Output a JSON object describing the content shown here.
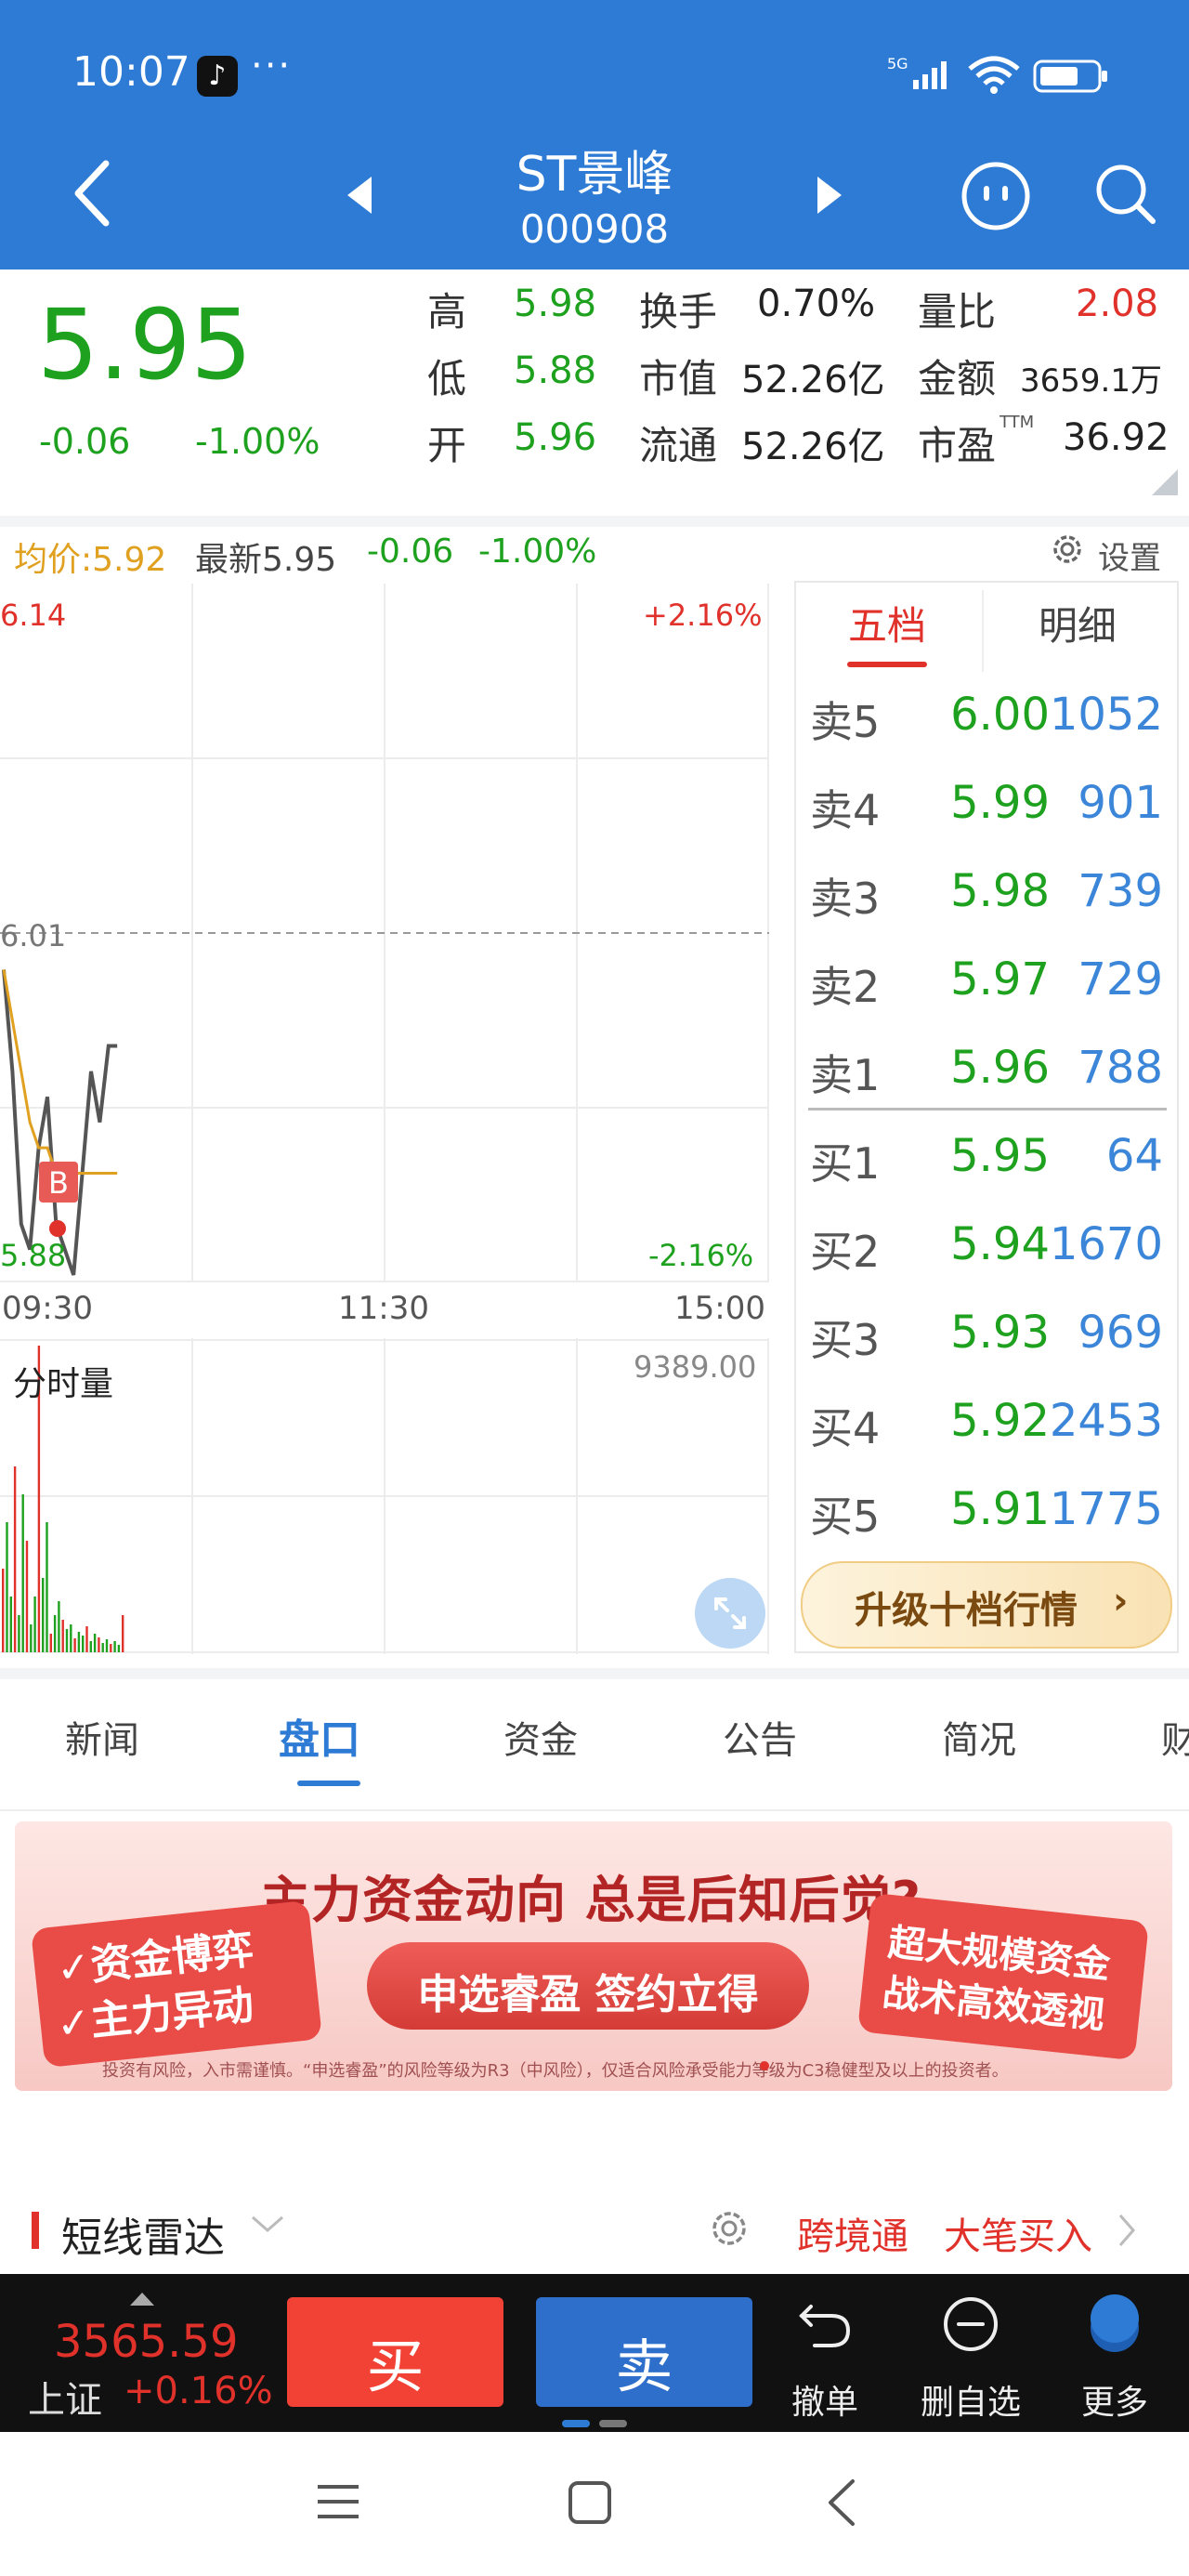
{
  "status_bar": {
    "time": "10:07",
    "dots": "···",
    "network": "5G"
  },
  "header": {
    "stock_name": "ST景峰",
    "stock_code": "000908"
  },
  "quote": {
    "price": "5.95",
    "change": "-0.06",
    "change_pct": "-1.00%",
    "high_label": "高",
    "high": "5.98",
    "low_label": "低",
    "low": "5.88",
    "open_label": "开",
    "open": "5.96",
    "turnover_label": "换手",
    "turnover": "0.70%",
    "mktcap_label": "市值",
    "mktcap": "52.26亿",
    "float_label": "流通",
    "float": "52.26亿",
    "volratio_label": "量比",
    "volratio": "2.08",
    "amount_label": "金额",
    "amount": "3659.1万",
    "pe_label": "市盈",
    "pe_sup": "TTM",
    "pe": "36.92"
  },
  "chart_info": {
    "avg": "均价:5.92",
    "latest": "最新5.95",
    "latest_change": "-0.06",
    "latest_pct": "-1.00%",
    "settings": "设置"
  },
  "chart": {
    "price_top": "6.14",
    "price_mid": "6.01",
    "price_bottom": "5.88",
    "pct_top": "+2.16%",
    "pct_bottom": "-2.16%",
    "times": [
      "09:30",
      "11:30",
      "15:00"
    ],
    "marker": "B",
    "volume_title": "分时量",
    "volume_max": "9389.00"
  },
  "chart_data": {
    "type": "line",
    "title": "",
    "ylim": [
      5.88,
      6.14
    ],
    "reference_price": 6.01,
    "x": [
      "09:30",
      "11:30",
      "15:00"
    ],
    "series": [
      {
        "name": "",
        "color": "#555555",
        "values": [
          6.0,
          5.96,
          5.9,
          5.89,
          5.93,
          5.95,
          5.9,
          5.89,
          5.88,
          5.92,
          5.96,
          5.94,
          5.97,
          5.97
        ]
      },
      {
        "name": "",
        "color": "#e0a020",
        "values": [
          6.0,
          5.98,
          5.96,
          5.94,
          5.93,
          5.93,
          5.92,
          5.92,
          5.92,
          5.92,
          5.92,
          5.92,
          5.92,
          5.92
        ]
      }
    ]
  },
  "order_book": {
    "tabs": [
      "五档",
      "明细"
    ],
    "asks": [
      {
        "label": "卖5",
        "price": "6.00",
        "volume": "1052"
      },
      {
        "label": "卖4",
        "price": "5.99",
        "volume": "901"
      },
      {
        "label": "卖3",
        "price": "5.98",
        "volume": "739"
      },
      {
        "label": "卖2",
        "price": "5.97",
        "volume": "729"
      },
      {
        "label": "卖1",
        "price": "5.96",
        "volume": "788"
      }
    ],
    "bids": [
      {
        "label": "买1",
        "price": "5.95",
        "volume": "64"
      },
      {
        "label": "买2",
        "price": "5.94",
        "volume": "1670"
      },
      {
        "label": "买3",
        "price": "5.93",
        "volume": "969"
      },
      {
        "label": "买4",
        "price": "5.92",
        "volume": "2453"
      },
      {
        "label": "买5",
        "price": "5.91",
        "volume": "1775"
      }
    ],
    "upgrade": "升级十档行情",
    "upgrade_chevron": "›"
  },
  "tabs": [
    "新闻",
    "盘口",
    "资金",
    "公告",
    "简况",
    "财"
  ],
  "banner": {
    "headline": "主力资金动向 总是后知后觉?",
    "left_1": "✓资金博弈",
    "left_2": "✓主力异动",
    "cta": "申选睿盈  签约立得",
    "right_1": "超大规模资金",
    "right_2": "战术高效透视",
    "disclaimer": "投资有风险，入市需谨慎。“申选睿盈”的风险等级为R3（中风险），仅适合风险承受能力等级为C3稳健型及以上的投资者。"
  },
  "radar": {
    "title": "短线雷达",
    "link_1": "跨境通",
    "link_2": "大笔买入"
  },
  "trade_bar": {
    "index_value": "3565.59",
    "index_name": "上证",
    "index_pct": "+0.16%",
    "buy": "买",
    "sell": "卖",
    "undo": "撤单",
    "remove_fav": "删自选",
    "more": "更多"
  },
  "colors": {
    "header": "#2e7bd6",
    "up": "#e0312b",
    "down": "#1ea11e",
    "accent": "#3b86d8"
  }
}
